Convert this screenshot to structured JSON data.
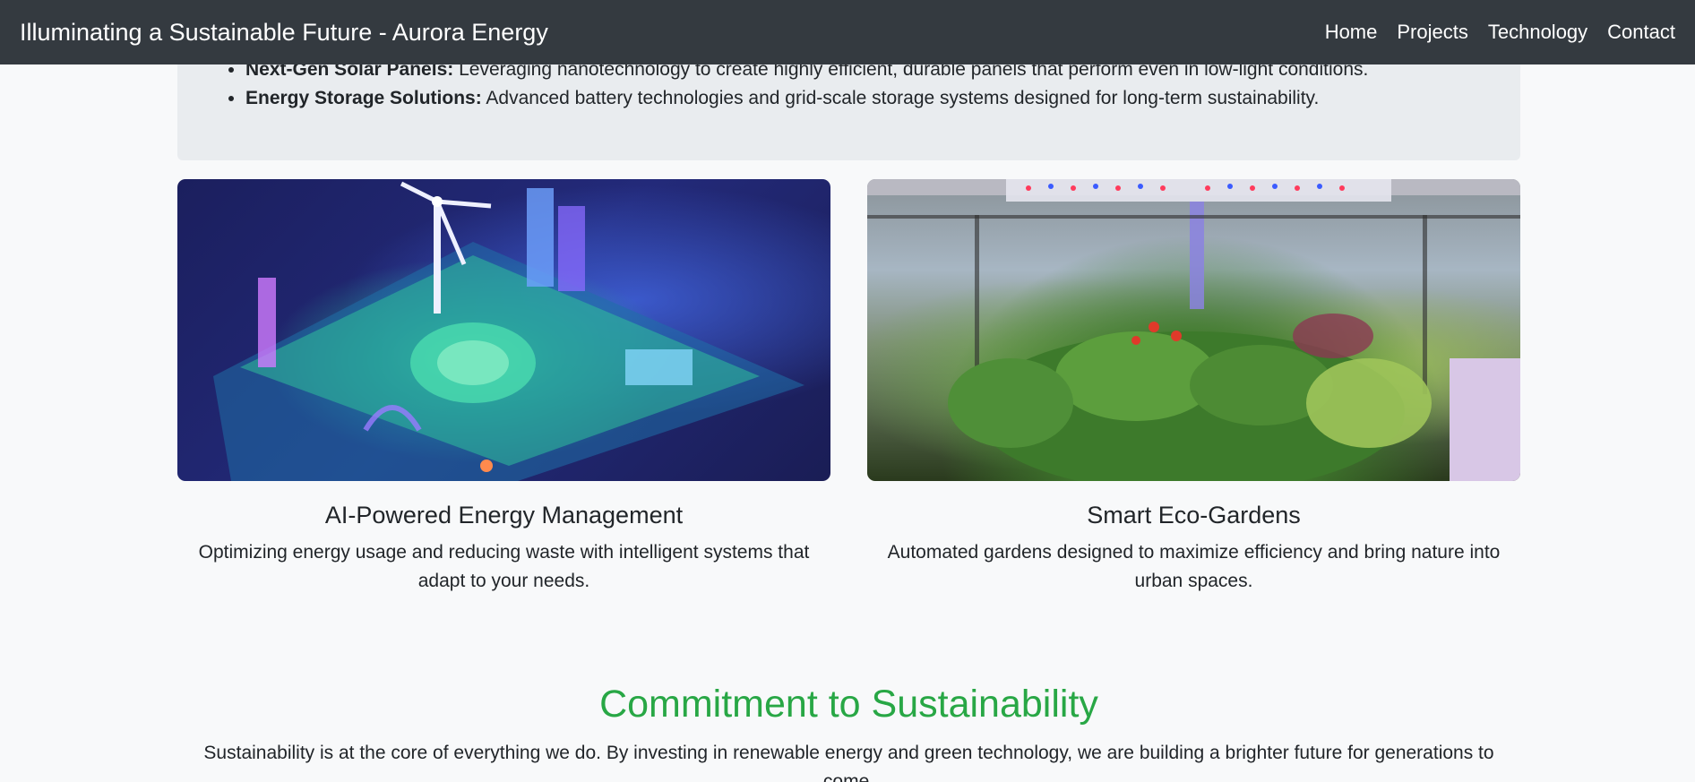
{
  "navbar": {
    "brand": "Illuminating a Sustainable Future - Aurora Energy",
    "links": [
      "Home",
      "Projects",
      "Technology",
      "Contact"
    ]
  },
  "technology": {
    "items": [
      {
        "title": "Next-Gen Solar Panels:",
        "text": " Leveraging nanotechnology to create highly efficient, durable panels that perform even in low-light conditions."
      },
      {
        "title": "Energy Storage Solutions:",
        "text": " Advanced battery technologies and grid-scale storage systems designed for long-term sustainability."
      }
    ]
  },
  "cards": [
    {
      "title": "AI-Powered Energy Management",
      "text": "Optimizing energy usage and reducing waste with intelligent systems that adapt to your needs."
    },
    {
      "title": "Smart Eco-Gardens",
      "text": "Automated gardens designed to maximize efficiency and bring nature into urban spaces."
    }
  ],
  "sustainability": {
    "title": "Commitment to Sustainability",
    "text": "Sustainability is at the core of everything we do. By investing in renewable energy and green technology, we are building a brighter future for generations to come."
  },
  "colors": {
    "navbar_bg": "#343a40",
    "page_bg": "#f8f9fa",
    "panel_bg": "#e9ecef",
    "accent_green": "#28a745"
  }
}
